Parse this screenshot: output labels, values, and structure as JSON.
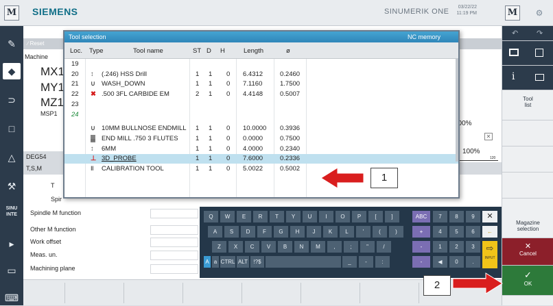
{
  "header": {
    "brand": "SIEMENS",
    "product": "SINUMERIK ONE",
    "date": "03/22/22",
    "time": "11:19 PM",
    "m_label": "M"
  },
  "base": {
    "reset": "Reset",
    "machine_label": "Machine",
    "axes": [
      "MX1",
      "MY1",
      "MZ1"
    ],
    "msp": "MSP1",
    "frame": "DEG54",
    "tsm": "T,S,M",
    "t_label": "T",
    "spin_label": "Spir",
    "override_1": "100%",
    "override_2": "100%",
    "override_scale": "120",
    "params": [
      "Spindle M function",
      "Other M function",
      "Work offset",
      "Meas. un.",
      "Machining plane"
    ]
  },
  "dialog": {
    "title": "Tool selection",
    "memory": "NC memory",
    "columns": [
      "Loc.",
      "Type",
      "Tool name",
      "ST",
      "D",
      "H",
      "Length",
      "ø"
    ],
    "rows": [
      {
        "loc": "19",
        "type": "",
        "name": "",
        "st": "",
        "d": "",
        "h": "",
        "length": "",
        "dia": ""
      },
      {
        "loc": "20",
        "type": "drill-icon",
        "name": "(.246) HSS Drill",
        "st": "1",
        "d": "1",
        "h": "0",
        "length": "6.4312",
        "dia": "0.2460"
      },
      {
        "loc": "21",
        "type": "endmill-icon",
        "name": "WASH_DOWN",
        "st": "1",
        "d": "1",
        "h": "0",
        "length": "7.1160",
        "dia": "1.7500"
      },
      {
        "loc": "22",
        "type": "endmill-red-icon",
        "name": ".500 3FL CARBIDE EM",
        "st": "2",
        "d": "1",
        "h": "0",
        "length": "4.4148",
        "dia": "0.5007"
      },
      {
        "loc": "23",
        "type": "",
        "name": "",
        "st": "",
        "d": "",
        "h": "",
        "length": "",
        "dia": ""
      },
      {
        "loc": "24",
        "type": "",
        "name": "",
        "st": "",
        "d": "",
        "h": "",
        "length": "",
        "dia": ""
      },
      {
        "loc": "",
        "type": "endmill-icon",
        "name": "10MM BULLNOSE ENDMILL",
        "st": "1",
        "d": "1",
        "h": "0",
        "length": "10.0000",
        "dia": "0.3936"
      },
      {
        "loc": "",
        "type": "facemill-icon",
        "name": "END MILL .750 3 FLUTES",
        "st": "1",
        "d": "1",
        "h": "0",
        "length": "0.0000",
        "dia": "0.7500"
      },
      {
        "loc": "",
        "type": "drill-icon",
        "name": "6MM",
        "st": "1",
        "d": "1",
        "h": "0",
        "length": "4.0000",
        "dia": "0.2340"
      },
      {
        "loc": "",
        "type": "probe-icon",
        "name": "3D_PROBE",
        "st": "1",
        "d": "1",
        "h": "0",
        "length": "7.6000",
        "dia": "0.2336"
      },
      {
        "loc": "",
        "type": "calibration-icon",
        "name": "CALIBRATION TOOL",
        "st": "1",
        "d": "1",
        "h": "0",
        "length": "5.0022",
        "dia": "0.5002"
      }
    ]
  },
  "keyboard": {
    "row1": [
      "Q",
      "W",
      "E",
      "R",
      "T",
      "Y",
      "U",
      "I",
      "O",
      "P",
      "[",
      "]"
    ],
    "row2": [
      "A",
      "S",
      "D",
      "F",
      "G",
      "H",
      "J",
      "K",
      "L",
      "'",
      "(",
      ")"
    ],
    "row3": [
      "Z",
      "X",
      "C",
      "V",
      "B",
      "N",
      "M",
      ",",
      ";",
      "\"",
      "/"
    ],
    "row4": [
      "A",
      "a",
      "CTRL",
      "ALT",
      "!?$",
      "_",
      "-",
      ":"
    ],
    "abc": "ABC",
    "num1": [
      "7",
      "8",
      "9"
    ],
    "num2": [
      "4",
      "5",
      "6"
    ],
    "num3": [
      "1",
      "2",
      "3"
    ],
    "num4": [
      "0",
      "."
    ],
    "ops": [
      "+",
      "-",
      "-"
    ],
    "input_label": "INPUT",
    "close": "✕"
  },
  "softkeys": {
    "tool_list": [
      "Tool",
      "list"
    ],
    "magazine_selection": [
      "Magazine",
      "selection"
    ],
    "cancel": "Cancel",
    "ok": "OK"
  },
  "callouts": [
    "1",
    "2"
  ],
  "colors": {
    "title_blue": "#2f86b9",
    "selection": "#bfe0ef",
    "cancel_red": "#8c1f2a",
    "ok_green": "#2d7a3a",
    "arrow_red": "#d91e1e",
    "keyboard_bg": "#243749",
    "brand": "#0f6e87"
  }
}
